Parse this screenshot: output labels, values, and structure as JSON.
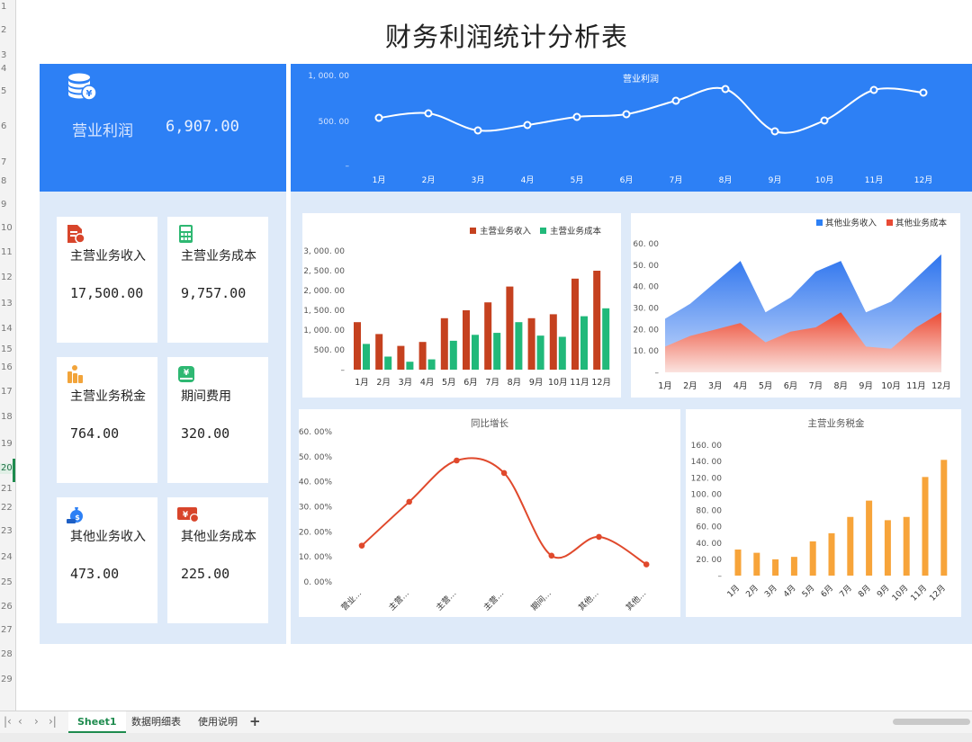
{
  "title": "财务利润统计分析表",
  "kpi_main": {
    "label": "营业利润",
    "value": "6,907.00"
  },
  "cards": [
    {
      "label": "主营业务收入",
      "value": "17,500.00",
      "icon": "document-money-icon",
      "color": "#d8452b"
    },
    {
      "label": "主营业务成本",
      "value": "9,757.00",
      "icon": "calculator-icon",
      "color": "#2eb872"
    },
    {
      "label": "主营业务税金",
      "value": "764.00",
      "icon": "coins-icon",
      "color": "#f2a43a"
    },
    {
      "label": "期间费用",
      "value": "320.00",
      "icon": "money-stack-icon",
      "color": "#2eb872"
    },
    {
      "label": "其他业务收入",
      "value": "473.00",
      "icon": "money-bag-icon",
      "color": "#2d80f5"
    },
    {
      "label": "其他业务成本",
      "value": "225.00",
      "icon": "wallet-icon",
      "color": "#d8452b"
    }
  ],
  "months": [
    "1月",
    "2月",
    "3月",
    "4月",
    "5月",
    "6月",
    "7月",
    "8月",
    "9月",
    "10月",
    "11月",
    "12月"
  ],
  "chart_data": [
    {
      "type": "line",
      "title": "营业利润",
      "x": [
        "1月",
        "2月",
        "3月",
        "4月",
        "5月",
        "6月",
        "7月",
        "8月",
        "9月",
        "10月",
        "11月",
        "12月"
      ],
      "series": [
        {
          "name": "营业利润",
          "values": [
            530,
            580,
            390,
            450,
            540,
            570,
            720,
            850,
            380,
            500,
            840,
            810
          ]
        }
      ],
      "ylim": [
        0,
        1000
      ],
      "yticks": [
        "1, 000. 00",
        "500. 00",
        "–"
      ]
    },
    {
      "type": "bar",
      "categories": [
        "1月",
        "2月",
        "3月",
        "4月",
        "5月",
        "6月",
        "7月",
        "8月",
        "9月",
        "10月",
        "11月",
        "12月"
      ],
      "series": [
        {
          "name": "主营业务收入",
          "color": "#c5411f",
          "values": [
            1200,
            900,
            600,
            700,
            1300,
            1500,
            1700,
            2100,
            1300,
            1400,
            2300,
            2500
          ]
        },
        {
          "name": "主营业务成本",
          "color": "#21b97a",
          "values": [
            650,
            330,
            200,
            260,
            730,
            880,
            930,
            1200,
            860,
            830,
            1350,
            1550
          ]
        }
      ],
      "ylim": [
        0,
        3000
      ],
      "yticks": [
        "3, 000. 00",
        "2, 500. 00",
        "2, 000. 00",
        "1, 500. 00",
        "1, 000. 00",
        "500. 00",
        "–"
      ],
      "legend": "top-right"
    },
    {
      "type": "area",
      "categories": [
        "1月",
        "2月",
        "3月",
        "4月",
        "5月",
        "6月",
        "7月",
        "8月",
        "9月",
        "10月",
        "11月",
        "12月"
      ],
      "series": [
        {
          "name": "其他业务收入",
          "color": "#2d80f5",
          "values": [
            25,
            32,
            42,
            52,
            28,
            35,
            47,
            52,
            28,
            33,
            44,
            55
          ]
        },
        {
          "name": "其他业务成本",
          "color": "#e84a35",
          "values": [
            12,
            17,
            20,
            23,
            14,
            19,
            21,
            28,
            12,
            11,
            21,
            28
          ]
        }
      ],
      "ylim": [
        0,
        60
      ],
      "yticks": [
        "60. 00",
        "50. 00",
        "40. 00",
        "30. 00",
        "20. 00",
        "10. 00",
        "–"
      ],
      "legend": "top-right"
    },
    {
      "type": "line",
      "title": "同比增长",
      "categories": [
        "营业…",
        "主营…",
        "主营…",
        "主营…",
        "期间…",
        "其他…",
        "其他…"
      ],
      "series": [
        {
          "name": "同比增长",
          "color": "#e0492c",
          "values": [
            14.5,
            32,
            48.5,
            43.5,
            10.5,
            18,
            7
          ]
        }
      ],
      "ylim": [
        0,
        60
      ],
      "yticks": [
        "60. 00%",
        "50. 00%",
        "40. 00%",
        "30. 00%",
        "20. 00%",
        "10. 00%",
        "0. 00%"
      ]
    },
    {
      "type": "bar",
      "title": "主营业务税金",
      "categories": [
        "1月",
        "2月",
        "3月",
        "4月",
        "5月",
        "6月",
        "7月",
        "8月",
        "9月",
        "10月",
        "11月",
        "12月"
      ],
      "series": [
        {
          "name": "主营业务税金",
          "color": "#f7a43a",
          "values": [
            32,
            28,
            20,
            23,
            42,
            52,
            72,
            92,
            68,
            72,
            121,
            142
          ]
        }
      ],
      "ylim": [
        0,
        160
      ],
      "yticks": [
        "160. 00",
        "140. 00",
        "120. 00",
        "100. 00",
        "80. 00",
        "60. 00",
        "40. 00",
        "20. 00",
        "–"
      ]
    }
  ],
  "row_numbers": [
    "1",
    "2",
    "3",
    "4",
    "5",
    "6",
    "7",
    "8",
    "9",
    "10",
    "11",
    "12",
    "13",
    "14",
    "15",
    "16",
    "17",
    "18",
    "19",
    "20",
    "21",
    "22",
    "23",
    "24",
    "25",
    "26",
    "27",
    "28",
    "29"
  ],
  "tabs": [
    "Sheet1",
    "数据明细表",
    "使用说明"
  ],
  "add_tab": "+",
  "nav_arrows": [
    "|‹",
    "‹",
    "›",
    "›|"
  ]
}
